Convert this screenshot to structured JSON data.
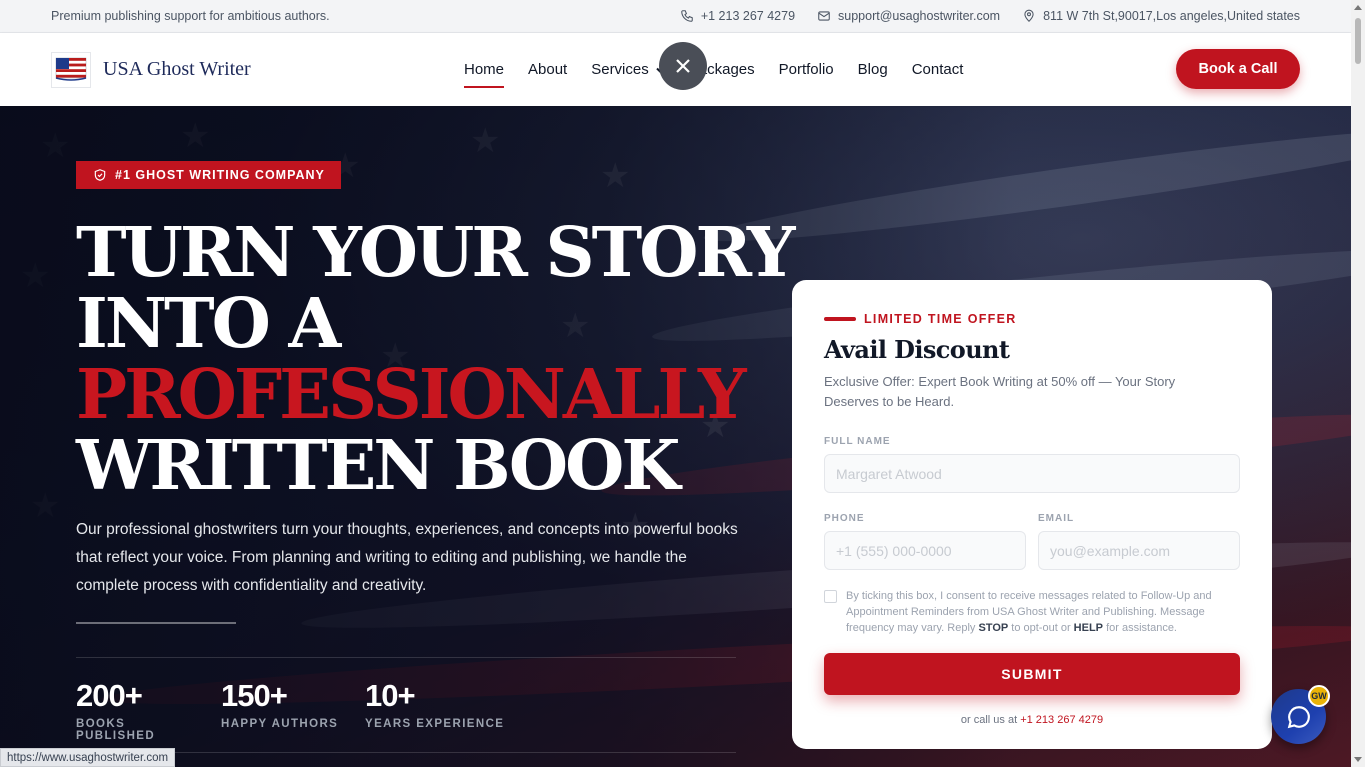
{
  "topbar": {
    "tagline": "Premium publishing support for ambitious authors.",
    "phone": "+1 213 267 4279",
    "email": "support@usaghostwriter.com",
    "address": "811 W 7th St,90017,Los angeles,United states"
  },
  "header": {
    "logo_text": "USA Ghost Writer",
    "nav": [
      "Home",
      "About",
      "Services",
      "Packages",
      "Portfolio",
      "Blog",
      "Contact"
    ],
    "active_nav": "Home",
    "cta_label": "Book a Call"
  },
  "hero": {
    "badge": "#1 GHOST WRITING COMPANY",
    "headline": [
      "TURN YOUR STORY",
      "INTO A",
      "PROFESSIONALLY",
      "WRITTEN BOOK"
    ],
    "description": "Our professional ghostwriters turn your thoughts, experiences, and concepts into powerful books that reflect your voice. From planning and writing to editing and publishing, we handle the complete process with confidentiality and creativity.",
    "stats": [
      {
        "value": "200+",
        "label": "BOOKS PUBLISHED"
      },
      {
        "value": "150+",
        "label": "HAPPY AUTHORS"
      },
      {
        "value": "10+",
        "label": "YEARS EXPERIENCE"
      }
    ]
  },
  "form": {
    "eyebrow": "LIMITED TIME OFFER",
    "title": "Avail Discount",
    "subtitle": "Exclusive Offer: Expert Book Writing at 50% off — Your Story Deserves to be Heard.",
    "full_name_label": "FULL NAME",
    "full_name_placeholder": "Margaret Atwood",
    "phone_label": "PHONE",
    "phone_placeholder": "+1 (555) 000-0000",
    "email_label": "EMAIL",
    "email_placeholder": "you@example.com",
    "consent_prefix": "By ticking this box, I consent to receive messages related to Follow-Up and Appointment Reminders from USA Ghost Writer and Publishing. Message frequency may vary. Reply ",
    "consent_stop": "STOP",
    "consent_mid": " to opt-out or ",
    "consent_help": "HELP",
    "consent_suffix": " for assistance.",
    "submit_label": "SUBMIT",
    "call_prefix": "or call us at ",
    "call_number": "+1 213 267 4279"
  },
  "chat": {
    "badge": "GW"
  },
  "status_url": "https://www.usaghostwriter.com",
  "colors": {
    "brand_red": "#c0141f",
    "navy": "#1e2a5a"
  }
}
